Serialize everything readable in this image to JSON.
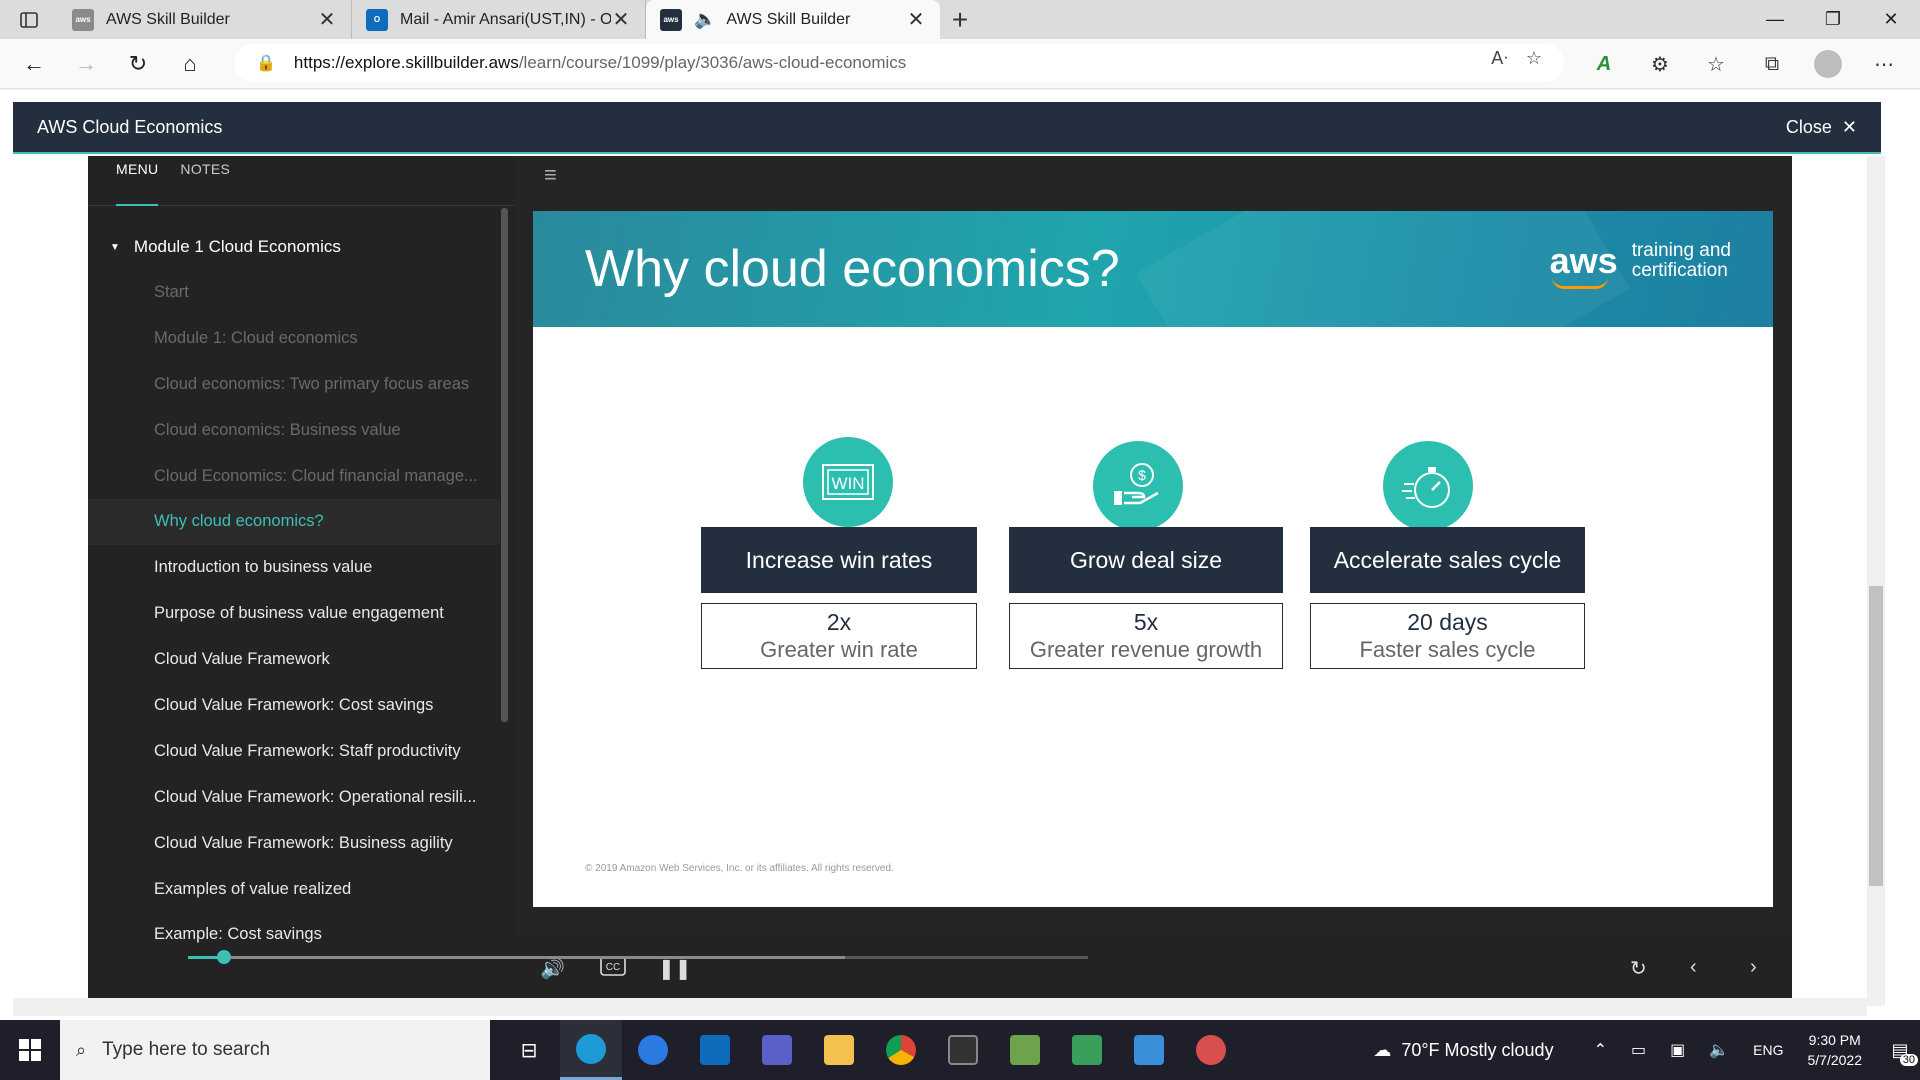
{
  "browser": {
    "tabs": [
      {
        "title": "AWS Skill Builder",
        "favicon": "aws-skill-builder-favicon",
        "active": false
      },
      {
        "title": "Mail - Amir Ansari(UST,IN) - Outl",
        "favicon": "outlook-favicon",
        "active": false
      },
      {
        "title": "AWS Skill Builder",
        "favicon": "aws-favicon",
        "active": true,
        "audio": true
      }
    ],
    "url_host": "https://explore.skillbuilder.aws",
    "url_path": "/learn/course/1099/play/3036/aws-cloud-economics"
  },
  "course": {
    "title": "AWS Cloud Economics",
    "close_label": "Close"
  },
  "sidebar": {
    "tabs": [
      "MENU",
      "NOTES"
    ],
    "module_title": "Module 1 Cloud Economics",
    "items": [
      {
        "label": "Start",
        "state": "done"
      },
      {
        "label": "Module 1: Cloud economics",
        "state": "done"
      },
      {
        "label": "Cloud economics: Two primary focus areas",
        "state": "done"
      },
      {
        "label": "Cloud economics: Business value",
        "state": "done"
      },
      {
        "label": "Cloud Economics: Cloud financial manage...",
        "state": "done"
      },
      {
        "label": "Why cloud economics?",
        "state": "current"
      },
      {
        "label": "Introduction to business value",
        "state": "todo"
      },
      {
        "label": "Purpose of business value engagement",
        "state": "todo"
      },
      {
        "label": "Cloud Value Framework",
        "state": "todo"
      },
      {
        "label": "Cloud Value Framework: Cost savings",
        "state": "todo"
      },
      {
        "label": "Cloud Value Framework: Staff productivity",
        "state": "todo"
      },
      {
        "label": "Cloud Value Framework: Operational resili...",
        "state": "todo"
      },
      {
        "label": "Cloud Value Framework: Business agility",
        "state": "todo"
      },
      {
        "label": "Examples of value realized",
        "state": "todo"
      },
      {
        "label": "Example: Cost savings",
        "state": "todo"
      }
    ]
  },
  "slide": {
    "title": "Why cloud economics?",
    "logo_text": "aws",
    "logo_line1": "training and",
    "logo_line2": "certification",
    "columns": [
      {
        "icon": "win-icon",
        "heading": "Increase win rates",
        "value": "2x",
        "desc": "Greater win rate"
      },
      {
        "icon": "dollar-hand-icon",
        "heading": "Grow deal size",
        "value": "5x",
        "desc": "Greater revenue growth"
      },
      {
        "icon": "stopwatch-icon",
        "heading": "Accelerate sales cycle",
        "value": "20 days",
        "desc": "Faster sales cycle"
      }
    ],
    "copyright": "© 2019 Amazon Web Services, Inc. or its affiliates. All rights reserved."
  },
  "player": {
    "progress": 0.04,
    "buffered": 0.73
  },
  "taskbar": {
    "search_placeholder": "Type here to search",
    "weather": "70°F  Mostly cloudy",
    "lang": "ENG",
    "time": "9:30 PM",
    "date": "5/7/2022",
    "notifications": "30"
  },
  "colors": {
    "accent": "#3cc0b4",
    "header_bg": "#232f3e",
    "sidebar_bg": "#232323"
  }
}
